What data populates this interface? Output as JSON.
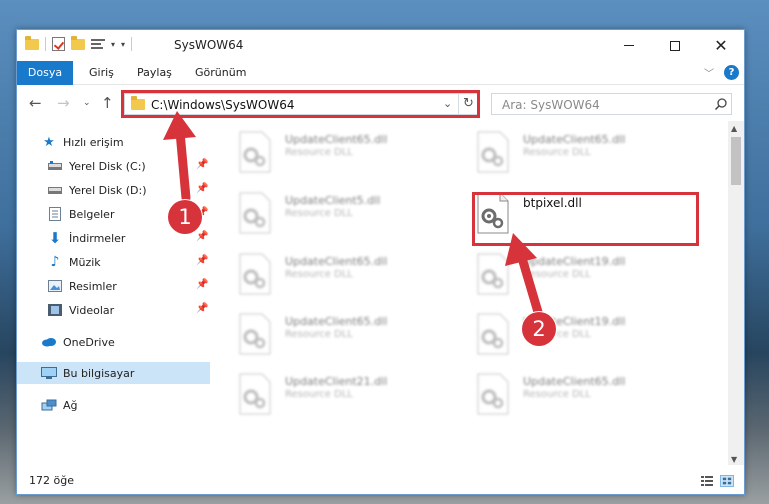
{
  "window": {
    "title": "SysWOW64"
  },
  "ribbon": {
    "tabs": [
      "Dosya",
      "Giriş",
      "Paylaş",
      "Görünüm"
    ]
  },
  "address": {
    "path": "C:\\Windows\\SysWOW64"
  },
  "search": {
    "placeholder": "Ara: SysWOW64"
  },
  "sidebar": {
    "items": [
      {
        "label": "Hızlı erişim"
      },
      {
        "label": "Yerel Disk (C:)"
      },
      {
        "label": "Yerel Disk (D:)"
      },
      {
        "label": "Belgeler"
      },
      {
        "label": "İndirmeler"
      },
      {
        "label": "Müzik"
      },
      {
        "label": "Resimler"
      },
      {
        "label": "Videolar"
      },
      {
        "label": "OneDrive"
      },
      {
        "label": "Bu bilgisayar"
      },
      {
        "label": "Ağ"
      }
    ]
  },
  "files": [
    {
      "name": "UpdateClient65.dll",
      "type": "Resource DLL"
    },
    {
      "name": "UpdateClient65.dll",
      "type": "Resource DLL"
    },
    {
      "name": "UpdateClient5.dll",
      "type": "Resource DLL"
    },
    {
      "name": "btpixel.dll",
      "type": ""
    },
    {
      "name": "UpdateClient65.dll",
      "type": "Resource DLL"
    },
    {
      "name": "UpdateClient19.dll",
      "type": "Resource DLL"
    },
    {
      "name": "UpdateClient65.dll",
      "type": "Resource DLL"
    },
    {
      "name": "UpdateClient19.dll",
      "type": "Resource DLL"
    },
    {
      "name": "UpdateClient21.dll",
      "type": "Resource DLL"
    },
    {
      "name": "UpdateClient65.dll",
      "type": "Resource DLL"
    }
  ],
  "status": {
    "count": "172 öğe"
  },
  "annotations": {
    "step1": "1",
    "step2": "2"
  },
  "colors": {
    "accent": "#1979ca",
    "highlight": "#d6333b",
    "selection": "#cce4f7"
  }
}
